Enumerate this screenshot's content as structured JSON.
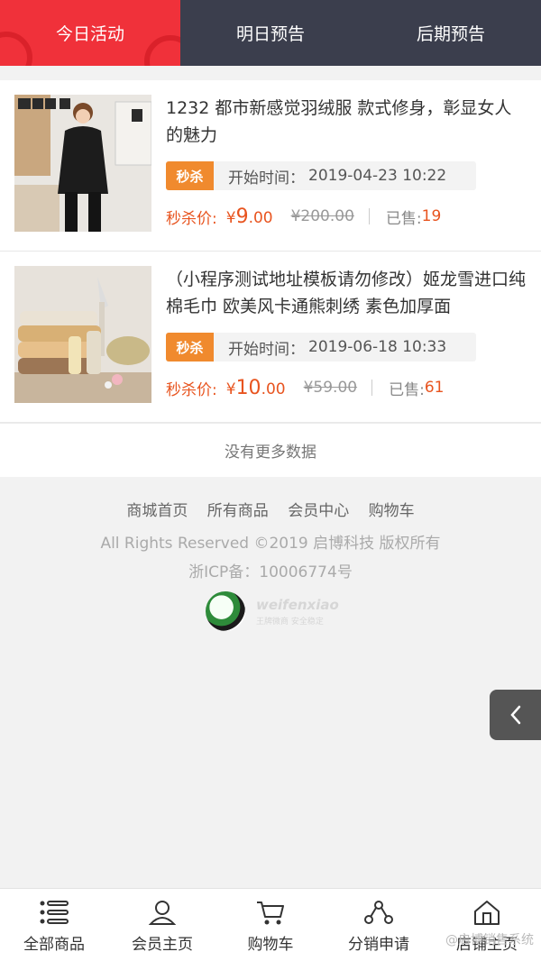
{
  "tabs": [
    {
      "label": "今日活动",
      "active": true
    },
    {
      "label": "明日预告",
      "active": false
    },
    {
      "label": "后期预告",
      "active": false
    }
  ],
  "products": [
    {
      "title": "1232 都市新感觉羽绒服 款式修身，彰显女人的魅力",
      "flash_badge": "秒杀",
      "start_label": "开始时间：",
      "start_time": "2019-04-23 10:22",
      "price_label": "秒杀价:",
      "currency": "¥",
      "price_main": "9",
      "price_cents": ".00",
      "original_price": "¥200.00",
      "sold_label": "已售:",
      "sold": "19",
      "image": "woman-in-leather-jacket"
    },
    {
      "title": "（小程序测试地址模板请勿修改）姬龙雪进口纯棉毛巾 欧美风卡通熊刺绣 素色加厚面",
      "flash_badge": "秒杀",
      "start_label": "开始时间：",
      "start_time": "2019-06-18 10:33",
      "price_label": "秒杀价:",
      "currency": "¥",
      "price_main": "10",
      "price_cents": ".00",
      "original_price": "¥59.00",
      "sold_label": "已售:",
      "sold": "61",
      "image": "stacked-towels"
    }
  ],
  "no_more": "没有更多数据",
  "footer": {
    "links": [
      "商城首页",
      "所有商品",
      "会员中心",
      "购物车"
    ],
    "rights": "All Rights Reserved ©2019 启博科技 版权所有",
    "icp": "浙ICP备：10006774号",
    "brand_name": "weifenxiao",
    "brand_tag": "王牌微商 安全稳定"
  },
  "side_tab_icon": "chevron-left-icon",
  "bottom_nav": [
    {
      "label": "全部商品",
      "icon": "list-icon"
    },
    {
      "label": "会员主页",
      "icon": "user-icon"
    },
    {
      "label": "购物车",
      "icon": "cart-icon"
    },
    {
      "label": "分销申请",
      "icon": "share-icon"
    },
    {
      "label": "店铺主页",
      "icon": "store-icon"
    }
  ],
  "watermark": "@启博销售系统",
  "colors": {
    "accent": "#f0313a",
    "tab_bar": "#3b3e4d",
    "price": "#e8541f",
    "flash_badge": "#f08a2e"
  }
}
